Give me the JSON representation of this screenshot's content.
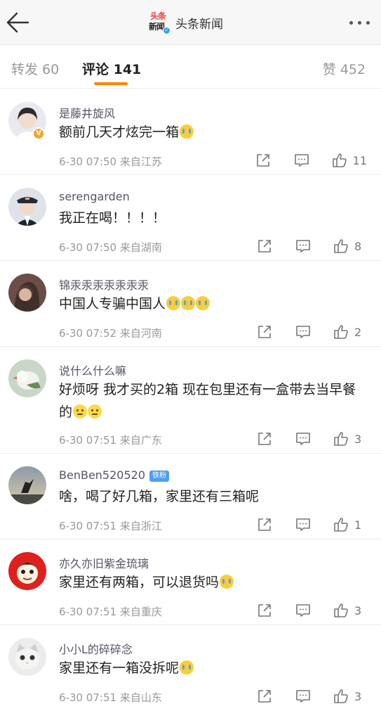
{
  "header": {
    "title": "头条新闻",
    "logo_text_top": "头条",
    "logo_text_bottom": "新闻"
  },
  "tabs": [
    {
      "label": "转发 60"
    },
    {
      "label": "评论 141"
    },
    {
      "label": "赞 452"
    }
  ],
  "comments": [
    {
      "user": "是藤井旋风",
      "text": "额前几天才炫完一箱",
      "emojis": [
        "cry"
      ],
      "time": "6-30 07:50",
      "location": "来自江苏",
      "likes": "11",
      "verified": true,
      "avatar_icon": "avatar-girl-icon"
    },
    {
      "user": "serengarden",
      "text": "我正在喝！！！！",
      "emojis": [],
      "time": "6-30 07:50",
      "location": "来自湖南",
      "likes": "8",
      "avatar_icon": "avatar-pilot-icon"
    },
    {
      "user": "锦汞汞汞汞汞汞汞",
      "text": "中国人专骗中国人",
      "emojis": [
        "cry",
        "cry",
        "cry"
      ],
      "time": "6-30 07:52",
      "location": "来自河南",
      "likes": "2",
      "avatar_icon": "avatar-woman-icon"
    },
    {
      "user": "说什么什么嘛",
      "text": "好烦呀 我才买的2箱 现在包里还有一盒带去当早餐的",
      "emojis": [
        "meh",
        "meh"
      ],
      "time": "6-30 07:51",
      "location": "来自广东",
      "likes": "3",
      "avatar_icon": "avatar-bird-icon"
    },
    {
      "user": "BenBen520520",
      "badge": "铁粉",
      "text": "啥，喝了好几箱，家里还有三箱呢",
      "emojis": [],
      "time": "6-30 07:51",
      "location": "来自浙江",
      "likes": "1",
      "avatar_icon": "avatar-sky-icon"
    },
    {
      "user": "亦久亦旧紫金琉璃",
      "text": "家里还有两箱，可以退货吗",
      "emojis": [
        "cry"
      ],
      "time": "6-30 07:51",
      "location": "来自重庆",
      "likes": "3",
      "avatar_icon": "avatar-cartoon-icon"
    },
    {
      "user": "小小L的碎碎念",
      "text": "家里还有一箱没拆呢",
      "emojis": [
        "cry"
      ],
      "time": "6-30 07:51",
      "location": "来自山东",
      "likes": "3",
      "avatar_icon": "avatar-cat-icon"
    }
  ],
  "colors": {
    "accent": "#ff8200",
    "username": "#556677",
    "meta": "#999999"
  }
}
